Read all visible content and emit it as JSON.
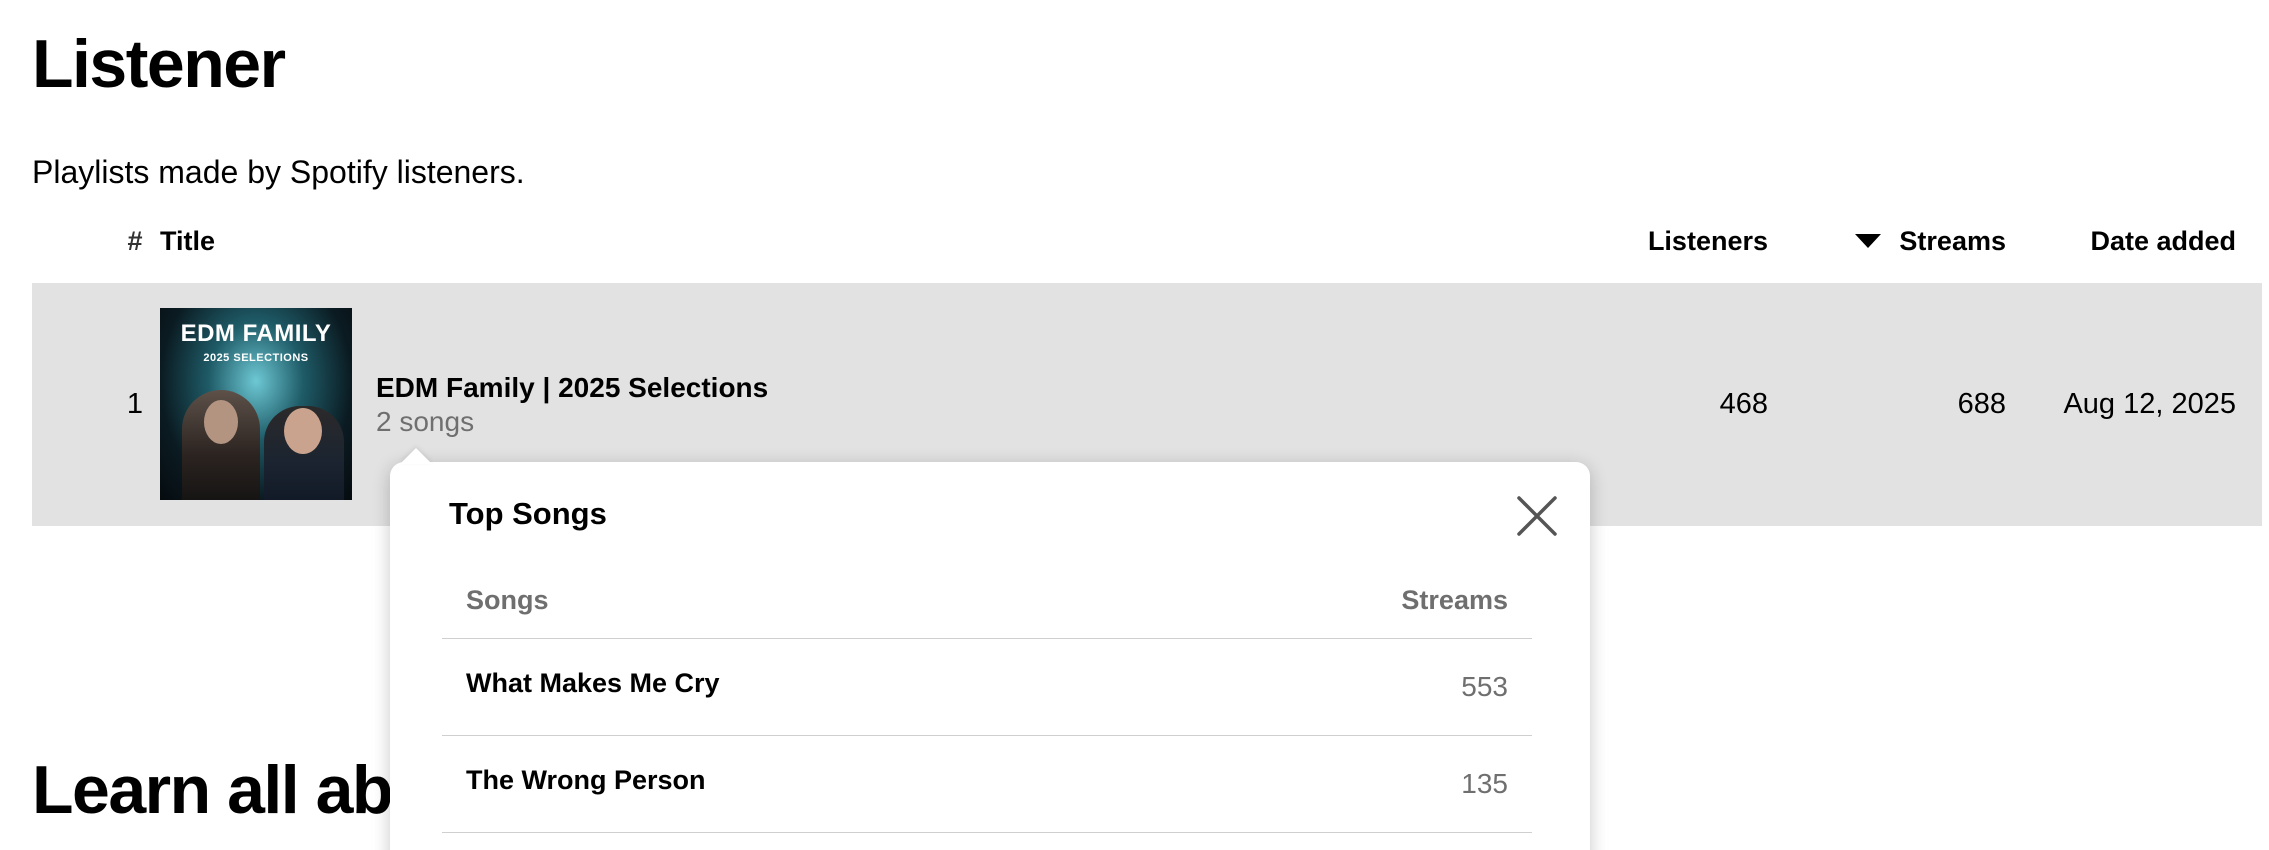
{
  "page": {
    "title": "Listener",
    "subtitle": "Playlists made by Spotify listeners.",
    "learn_heading": "Learn all abo"
  },
  "table": {
    "columns": {
      "num": "#",
      "title": "Title",
      "listeners": "Listeners",
      "streams": "Streams",
      "date_added": "Date added"
    },
    "sort": {
      "column": "streams",
      "direction": "descending",
      "icon": "caret-down-icon"
    },
    "rows": [
      {
        "num": "1",
        "cover": {
          "title": "EDM FAMILY",
          "subtitle": "2025 SELECTIONS"
        },
        "name": "EDM Family | 2025 Selections",
        "song_count": "2 songs",
        "listeners": "468",
        "streams": "688",
        "date_added": "Aug 12, 2025"
      }
    ]
  },
  "popover": {
    "title": "Top Songs",
    "close_icon": "close-icon",
    "columns": {
      "songs": "Songs",
      "streams": "Streams"
    },
    "songs": [
      {
        "name": "What Makes Me Cry",
        "streams": "553"
      },
      {
        "name": "The Wrong Person",
        "streams": "135"
      }
    ]
  }
}
